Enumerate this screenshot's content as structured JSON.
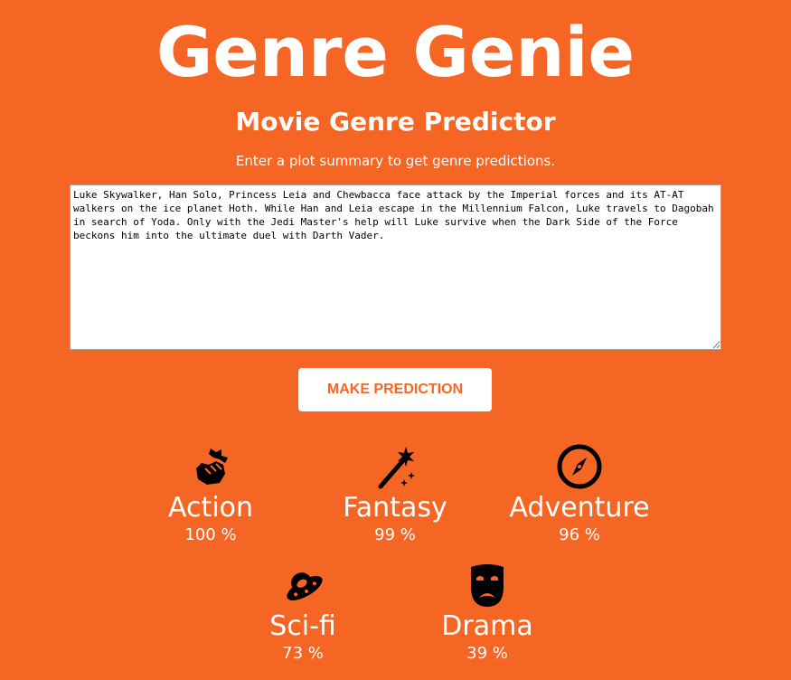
{
  "header": {
    "title": "Genre Genie",
    "subtitle": "Movie Genre Predictor",
    "instructions": "Enter a plot summary to get genre predictions."
  },
  "input": {
    "plot_summary": "Luke Skywalker, Han Solo, Princess Leia and Chewbacca face attack by the Imperial forces and its AT-AT walkers on the ice planet Hoth. While Han and Leia escape in the Millennium Falcon, Luke travels to Dagobah in search of Yoda. Only with the Jedi Master's help will Luke survive when the Dark Side of the Force beckons him into the ultimate duel with Darth Vader."
  },
  "actions": {
    "predict_label": "MAKE PREDICTION"
  },
  "predictions": [
    {
      "genre": "Action",
      "percent": "100 %",
      "icon": "fist-icon"
    },
    {
      "genre": "Fantasy",
      "percent": "99 %",
      "icon": "magic-wand-icon"
    },
    {
      "genre": "Adventure",
      "percent": "96 %",
      "icon": "compass-icon"
    },
    {
      "genre": "Sci-fi",
      "percent": "73 %",
      "icon": "ufo-icon"
    },
    {
      "genre": "Drama",
      "percent": "39 %",
      "icon": "theater-mask-icon"
    }
  ],
  "colors": {
    "background": "#f56624",
    "button_text": "#f56624",
    "text": "#ffffff",
    "icon": "#000000"
  }
}
